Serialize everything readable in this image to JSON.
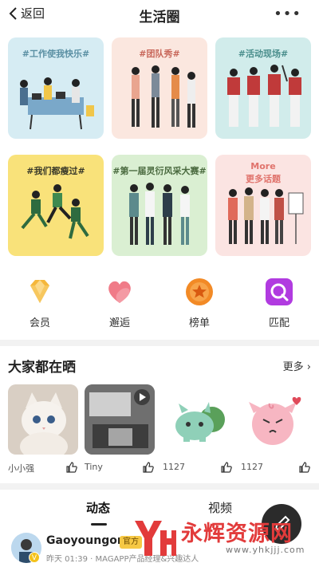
{
  "header": {
    "back_label": "返回",
    "title": "生活圈"
  },
  "topics": [
    {
      "title": "#工作使我快乐#",
      "bg": "#d6ecf3",
      "color": "#5a8fa3"
    },
    {
      "title": "#团队秀#",
      "bg": "#fbe7df",
      "color": "#c8675a"
    },
    {
      "title": "#活动现场#",
      "bg": "#d1eceb",
      "color": "#4a8e8c"
    },
    {
      "title": "#我们都瘦过#",
      "bg": "#f9e27a",
      "color": "#3a3a2a"
    },
    {
      "title": "#第一届灵衍风采大赛#",
      "bg": "#daefd2",
      "color": "#4a6a3f"
    },
    {
      "title_line1": "More",
      "title_line2": "更多话题",
      "bg": "#fbe4e2",
      "color": "#e0736c"
    }
  ],
  "menu": [
    {
      "label": "会员",
      "icon": "diamond-icon",
      "color": "#f5b73b"
    },
    {
      "label": "邂逅",
      "icon": "heart-icon",
      "color": "#f07b88"
    },
    {
      "label": "榜单",
      "icon": "medal-icon",
      "color": "#f28a26"
    },
    {
      "label": "匹配",
      "icon": "match-search-icon",
      "color": "#b13be0"
    }
  ],
  "share": {
    "title": "大家都在晒",
    "more_label": "更多",
    "items": [
      {
        "name": "小小强"
      },
      {
        "name": "Tiny"
      },
      {
        "name": "1127"
      },
      {
        "name": "1127"
      }
    ]
  },
  "tabs": {
    "active": "动态",
    "other": "视频"
  },
  "post": {
    "author": "Gaoyoungor",
    "badge": "官方",
    "meta": "昨天 01:39 · MAGAPP产品经理&兴趣达人",
    "verified": "V"
  },
  "watermark": {
    "text": "永辉资源网",
    "url": "www.yhkjjj.com"
  }
}
